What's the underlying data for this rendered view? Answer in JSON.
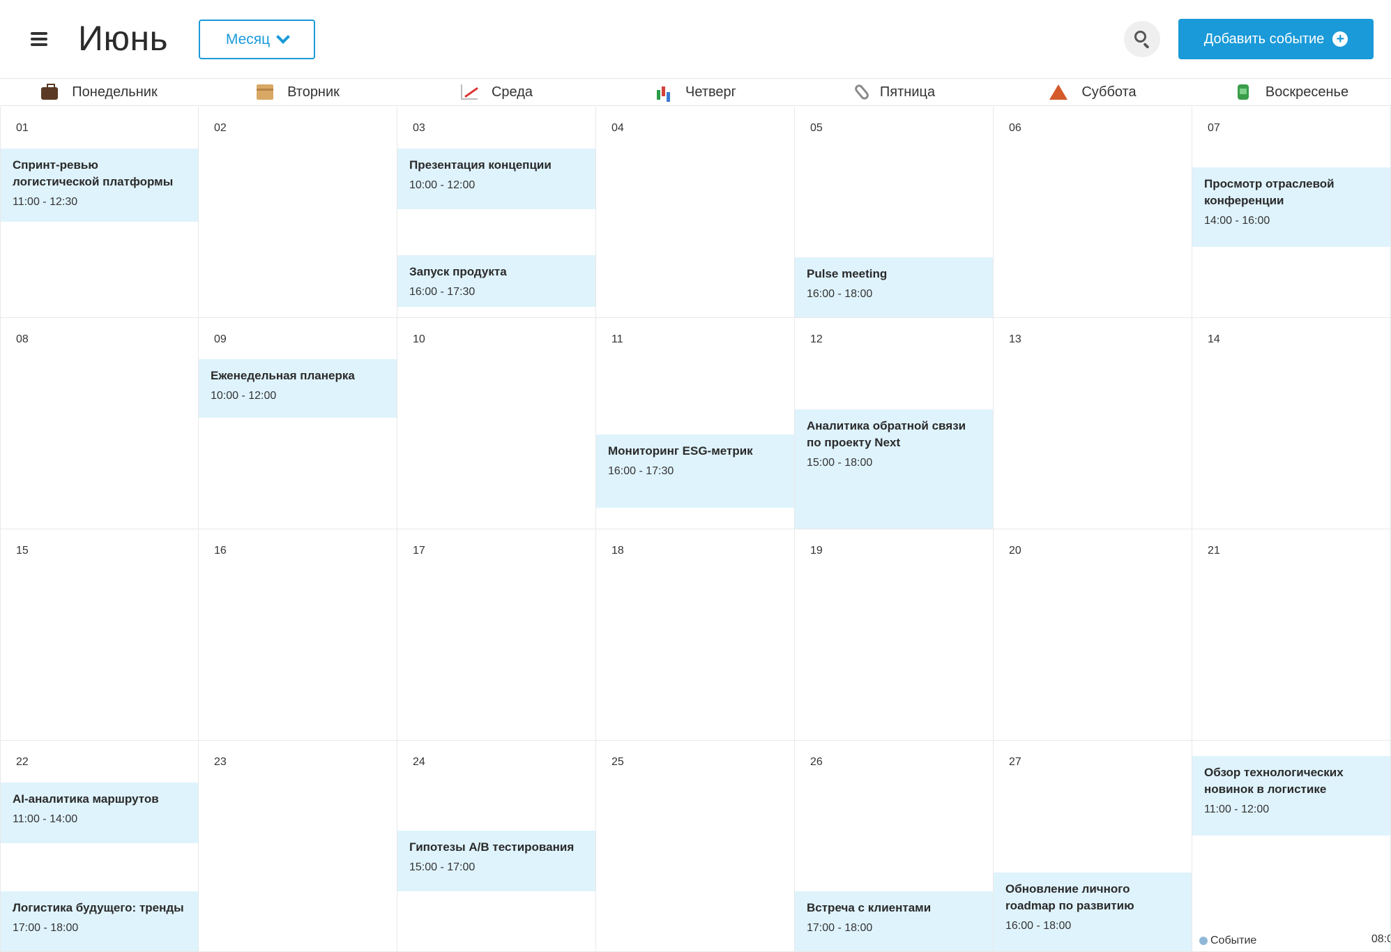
{
  "header": {
    "title": "Июнь",
    "view_label": "Месяц",
    "add_event_label": "Добавить событие"
  },
  "weekdays": [
    {
      "label": "Понедельник",
      "icon": "briefcase-icon"
    },
    {
      "label": "Вторник",
      "icon": "package-icon"
    },
    {
      "label": "Среда",
      "icon": "chart-increasing-icon"
    },
    {
      "label": "Четверг",
      "icon": "bar-chart-icon"
    },
    {
      "label": "Пятница",
      "icon": "paperclip-icon"
    },
    {
      "label": "Суббота",
      "icon": "tent-icon"
    },
    {
      "label": "Воскресенье",
      "icon": "battery-icon"
    }
  ],
  "days": [
    {
      "num": "01",
      "events": [
        {
          "title": "Спринт-ревью логистической платформы",
          "time": "11:00 - 12:30"
        }
      ]
    },
    {
      "num": "02",
      "events": []
    },
    {
      "num": "03",
      "events": [
        {
          "title": "Презентация концепции",
          "time": "10:00 - 12:00"
        },
        {
          "title": "Запуск продукта",
          "time": "16:00 - 17:30"
        }
      ]
    },
    {
      "num": "04",
      "events": []
    },
    {
      "num": "05",
      "events": [
        {
          "title": "Pulse meeting",
          "time": "16:00 - 18:00"
        }
      ]
    },
    {
      "num": "06",
      "events": []
    },
    {
      "num": "07",
      "events": [
        {
          "title": "Просмотр отраслевой конференции",
          "time": "14:00 - 16:00"
        }
      ]
    },
    {
      "num": "08",
      "events": []
    },
    {
      "num": "09",
      "events": [
        {
          "title": "Еженедельная планерка",
          "time": "10:00 - 12:00"
        }
      ]
    },
    {
      "num": "10",
      "events": []
    },
    {
      "num": "11",
      "events": [
        {
          "title": "Мониторинг ESG-метрик",
          "time": "16:00 - 17:30"
        }
      ]
    },
    {
      "num": "12",
      "events": [
        {
          "title": "Аналитика обратной связи по проекту Next",
          "time": "15:00 - 18:00"
        }
      ]
    },
    {
      "num": "13",
      "events": []
    },
    {
      "num": "14",
      "events": []
    },
    {
      "num": "15",
      "events": []
    },
    {
      "num": "16",
      "events": []
    },
    {
      "num": "17",
      "events": []
    },
    {
      "num": "18",
      "events": []
    },
    {
      "num": "19",
      "events": []
    },
    {
      "num": "20",
      "events": []
    },
    {
      "num": "21",
      "events": []
    },
    {
      "num": "22",
      "events": [
        {
          "title": "AI-аналитика маршрутов",
          "time": "11:00 - 14:00"
        },
        {
          "title": "Логистика будущего: тренды",
          "time": "17:00 - 18:00"
        }
      ]
    },
    {
      "num": "23",
      "events": []
    },
    {
      "num": "24",
      "events": [
        {
          "title": "Гипотезы A/B тестирования",
          "time": "15:00 - 17:00"
        }
      ]
    },
    {
      "num": "25",
      "events": []
    },
    {
      "num": "26",
      "events": [
        {
          "title": "Встреча с клиентами",
          "time": "17:00 - 18:00"
        }
      ]
    },
    {
      "num": "27",
      "events": [
        {
          "title": "Обновление личного roadmap по развитию",
          "time": "16:00 - 18:00"
        }
      ]
    },
    {
      "num": "",
      "events": [
        {
          "title": "Обзор технологических новинок в логистике",
          "time": "11:00 - 12:00"
        }
      ]
    }
  ],
  "legend": {
    "label": "Событие",
    "time": "08:0"
  },
  "colors": {
    "accent": "#1a9ad9",
    "event_bg": "#dff3fc"
  }
}
